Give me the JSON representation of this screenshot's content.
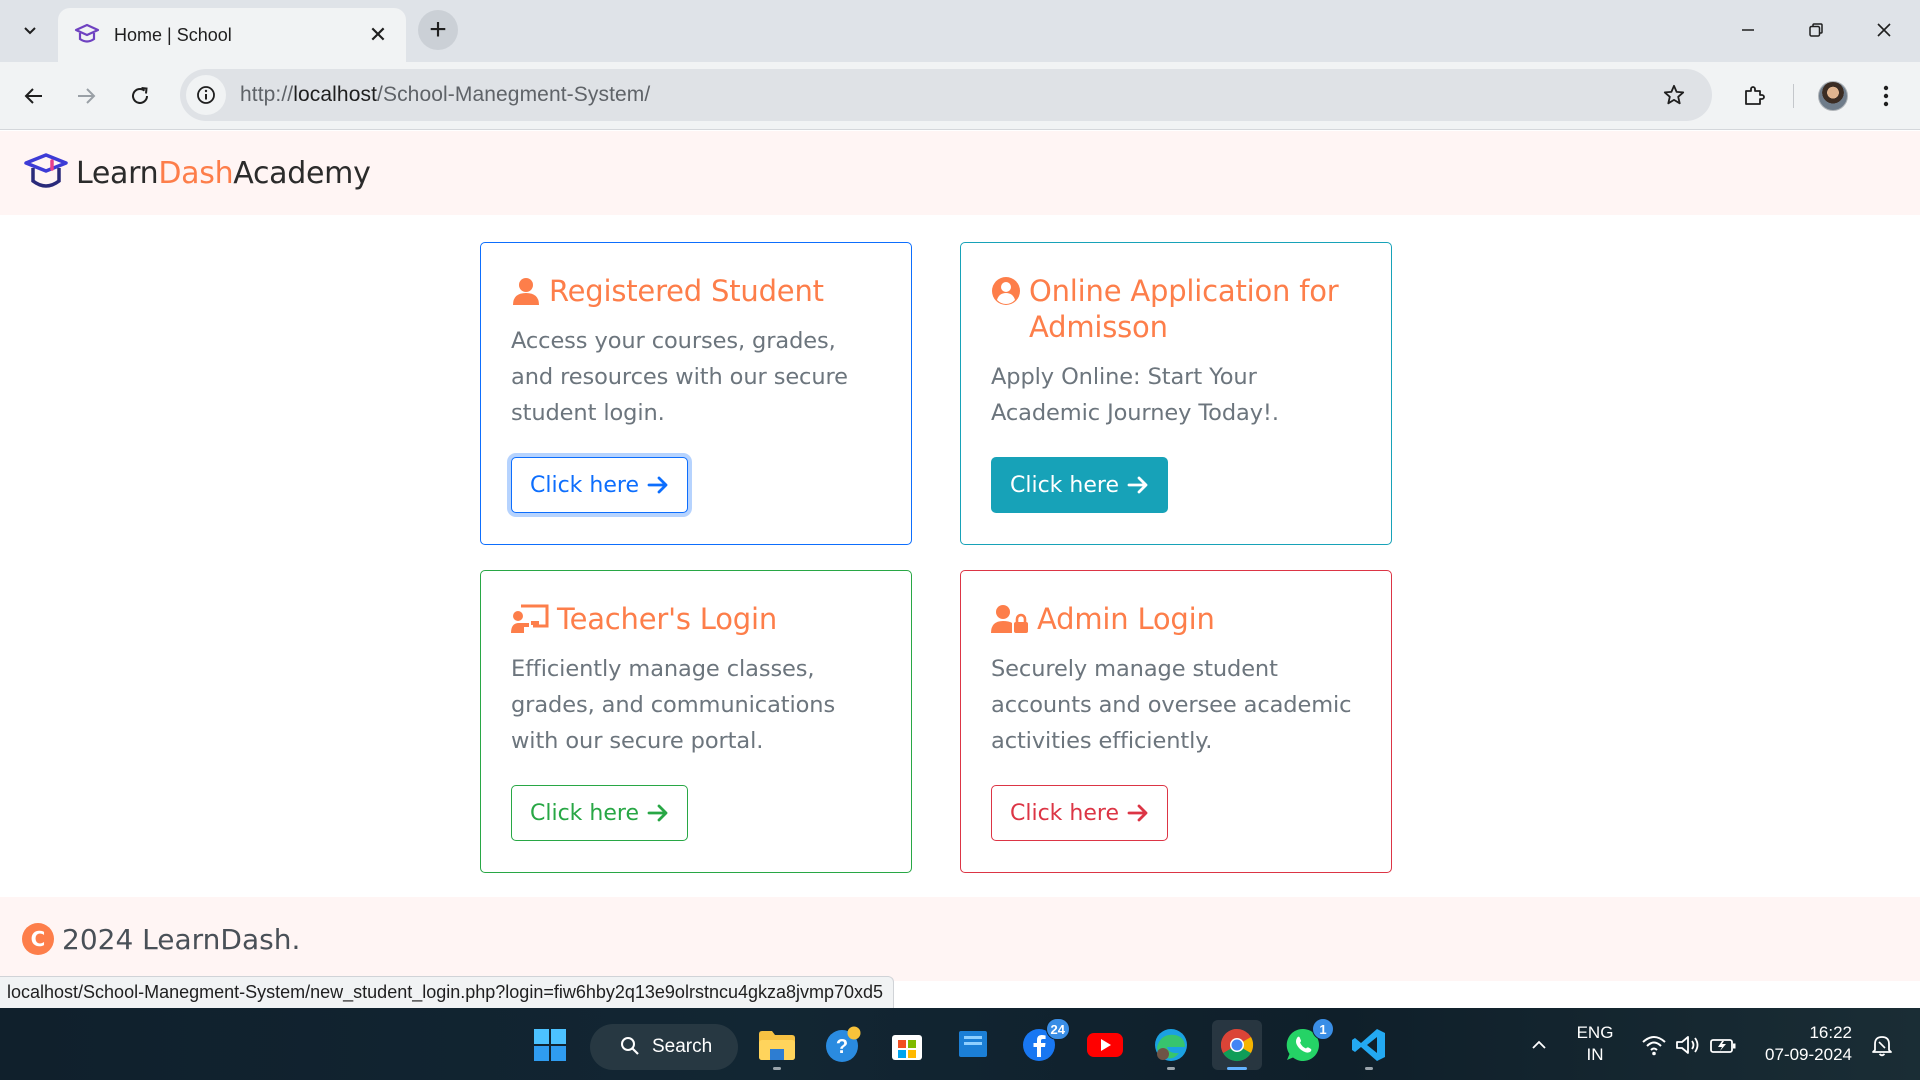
{
  "browser": {
    "tab_title": "Home | School",
    "tab_close_glyph": "✕",
    "new_tab_glyph": "+",
    "url_scheme": "http://",
    "url_host": "localhost",
    "url_path": "/School-Manegment-System/",
    "status_url": "localhost/School-Manegment-System/new_student_login.php?login=fiw6hby2q13e9olrstncu4gkza8jvmp70xd5"
  },
  "header": {
    "brand_part1": "Learn",
    "brand_part2": "Dash",
    "brand_part3": "Academy"
  },
  "cards": [
    {
      "title": "Registered Student",
      "icon": "user-icon",
      "text": "Access your courses, grades, and resources with our secure student login.",
      "button": "Click here",
      "color": "#0d6efd"
    },
    {
      "title": "Online Application for Admisson",
      "icon": "user-circle-icon",
      "text": "Apply Online: Start Your Academic Journey Today!.",
      "button": "Click here",
      "color": "#17a2b8"
    },
    {
      "title": "Teacher's Login",
      "icon": "chalkboard-teacher-icon",
      "text": "Efficiently manage classes, grades, and communications with our secure portal.",
      "button": "Click here",
      "color": "#28a745"
    },
    {
      "title": "Admin Login",
      "icon": "user-lock-icon",
      "text": "Securely manage student accounts and oversee academic activities efficiently.",
      "button": "Click here",
      "color": "#dc3545"
    }
  ],
  "footer": {
    "copyright_glyph": "C",
    "text": "2024 LearnDash."
  },
  "taskbar": {
    "search_label": "Search",
    "language_line1": "ENG",
    "language_line2": "IN",
    "time": "16:22",
    "date": "07-09-2024",
    "facebook_badge": "24",
    "whatsapp_badge": "1"
  },
  "colors": {
    "accent": "#fd7e4a",
    "header_bg": "#fff5f4"
  }
}
